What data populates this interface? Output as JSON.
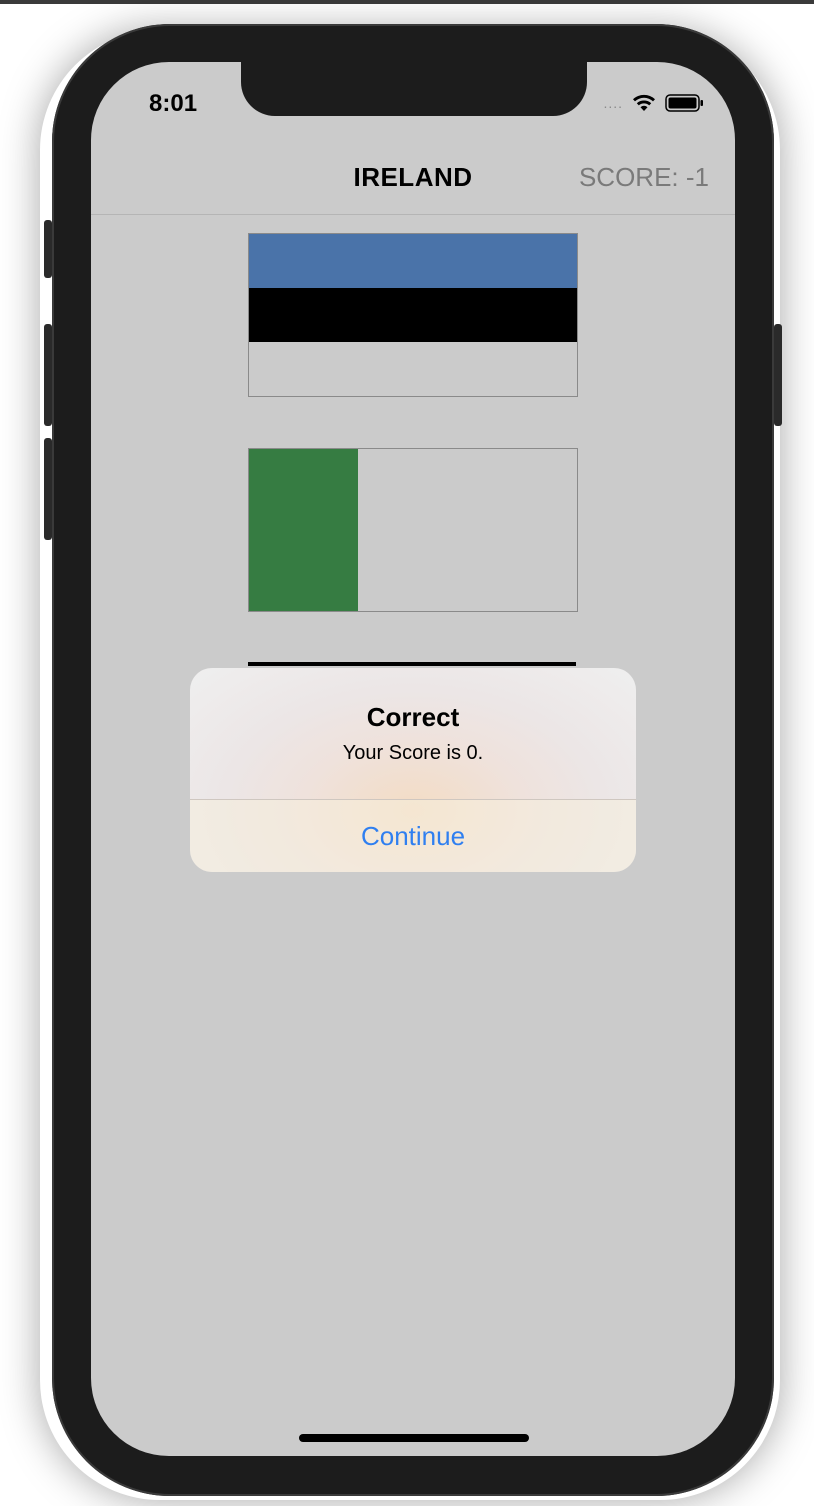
{
  "status_bar": {
    "time": "8:01",
    "signal": "....",
    "icons": [
      "wifi-icon",
      "battery-icon"
    ]
  },
  "navbar": {
    "title": "IRELAND",
    "score": "SCORE: -1"
  },
  "flags": [
    {
      "name": "estonia",
      "colors": [
        "#4a73a9",
        "#000000",
        "#cbcbcb"
      ],
      "orientation": "horizontal"
    },
    {
      "name": "ireland",
      "colors": [
        "#367c42",
        "#cbcbcb",
        "#c26627"
      ],
      "orientation": "vertical"
    },
    {
      "name": "partially-hidden",
      "colors": [
        "#000000"
      ]
    }
  ],
  "alert": {
    "title": "Correct",
    "message": "Your Score is 0.",
    "button": "Continue"
  },
  "colors": {
    "screen_bg": "#cbcbcb",
    "accent": "#2f7ff0",
    "device": "#1c1c1c"
  }
}
